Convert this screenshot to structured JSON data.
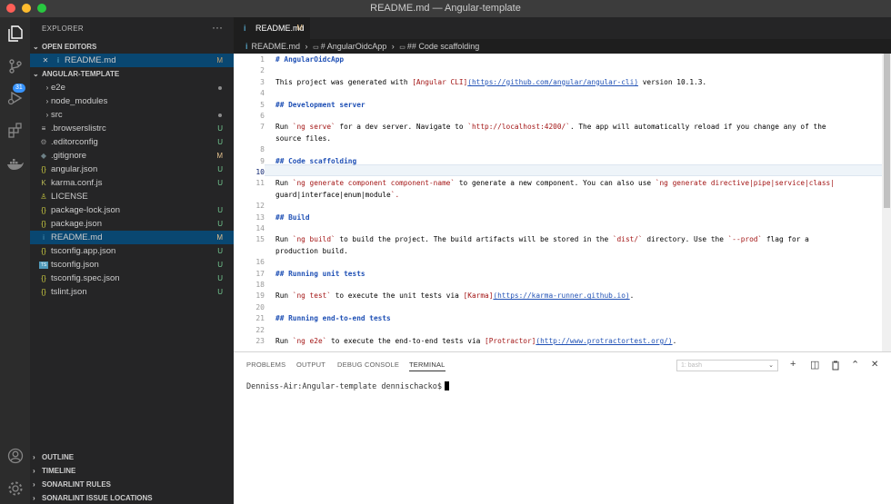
{
  "window": {
    "title": "README.md — Angular-template"
  },
  "traffic_lights": {
    "close": "#ff5f57",
    "minimize": "#febc2e",
    "zoom": "#28c840"
  },
  "activity_bar": {
    "badge": "31"
  },
  "sidebar": {
    "title": "EXPLORER",
    "more": "···",
    "open_editors": {
      "label": "OPEN EDITORS",
      "items": [
        {
          "close": "✕",
          "name": "README.md",
          "status": "M"
        }
      ]
    },
    "project": {
      "label": "ANGULAR-TEMPLATE",
      "items": [
        {
          "name": "e2e",
          "icon": "›",
          "status": ""
        },
        {
          "name": "node_modules",
          "icon": "›",
          "status": ""
        },
        {
          "name": "src",
          "icon": "›",
          "status": ""
        },
        {
          "name": ".browserslistrc",
          "icon": "≡",
          "status": "U"
        },
        {
          "name": ".editorconfig",
          "icon": "⚙",
          "status": "U"
        },
        {
          "name": ".gitignore",
          "icon": "◆",
          "status": "M"
        },
        {
          "name": "angular.json",
          "icon": "{}",
          "status": "U"
        },
        {
          "name": "karma.conf.js",
          "icon": "K",
          "status": "U"
        },
        {
          "name": "LICENSE",
          "icon": "♙",
          "status": ""
        },
        {
          "name": "package-lock.json",
          "icon": "{}",
          "status": "U"
        },
        {
          "name": "package.json",
          "icon": "{}",
          "status": "U"
        },
        {
          "name": "README.md",
          "icon": "i",
          "status": "M"
        },
        {
          "name": "tsconfig.app.json",
          "icon": "{}",
          "status": "U"
        },
        {
          "name": "tsconfig.json",
          "icon": "TS",
          "status": "U"
        },
        {
          "name": "tsconfig.spec.json",
          "icon": "{}",
          "status": "U"
        },
        {
          "name": "tslint.json",
          "icon": "{}",
          "status": "U"
        }
      ]
    },
    "bottom_sections": [
      "OUTLINE",
      "TIMELINE",
      "SONARLINT RULES",
      "SONARLINT ISSUE LOCATIONS"
    ]
  },
  "editor": {
    "tab": {
      "label": "README.md",
      "status": "M"
    },
    "breadcrumb": {
      "file": "README.md",
      "sep": "›",
      "h1": "# AngularOidcApp",
      "h2": "## Code scaffolding"
    },
    "lines": [
      {
        "n": "1",
        "text": "# AngularOidcApp"
      },
      {
        "n": "2",
        "text": ""
      },
      {
        "n": "3",
        "text": "This project was generated with [Angular CLI](https://github.com/angular/angular-cli) version 10.1.3."
      },
      {
        "n": "4",
        "text": ""
      },
      {
        "n": "5",
        "text": "## Development server"
      },
      {
        "n": "6",
        "text": ""
      },
      {
        "n": "7",
        "text": "Run `ng serve` for a dev server. Navigate to `http://localhost:4200/`. The app will automatically reload if you change any of the"
      },
      {
        "n": "",
        "text": "source files."
      },
      {
        "n": "8",
        "text": ""
      },
      {
        "n": "9",
        "text": "## Code scaffolding"
      },
      {
        "n": "10",
        "text": ""
      },
      {
        "n": "11",
        "text": "Run `ng generate component component-name` to generate a new component. You can also use `ng generate directive|pipe|service|class|"
      },
      {
        "n": "",
        "text": "guard|interface|enum|module`."
      },
      {
        "n": "12",
        "text": ""
      },
      {
        "n": "13",
        "text": "## Build"
      },
      {
        "n": "14",
        "text": ""
      },
      {
        "n": "15",
        "text": "Run `ng build` to build the project. The build artifacts will be stored in the `dist/` directory. Use the `--prod` flag for a"
      },
      {
        "n": "",
        "text": "production build."
      },
      {
        "n": "16",
        "text": ""
      },
      {
        "n": "17",
        "text": "## Running unit tests"
      },
      {
        "n": "18",
        "text": ""
      },
      {
        "n": "19",
        "text": "Run `ng test` to execute the unit tests via [Karma](https://karma-runner.github.io)."
      },
      {
        "n": "20",
        "text": ""
      },
      {
        "n": "21",
        "text": "## Running end-to-end tests"
      },
      {
        "n": "22",
        "text": ""
      },
      {
        "n": "23",
        "text": "Run `ng e2e` to execute the end-to-end tests via [Protractor](http://www.protractortest.org/)."
      }
    ]
  },
  "panel": {
    "tabs": [
      "PROBLEMS",
      "OUTPUT",
      "DEBUG CONSOLE",
      "TERMINAL"
    ],
    "active_tab": "TERMINAL",
    "terminal_select": "1: bash",
    "icons": {
      "add": "+",
      "split": "◫",
      "trash": "🗑",
      "maximize": "⌃",
      "close": "✕"
    },
    "prompt": "Denniss-Air:Angular-template dennischacko$"
  }
}
